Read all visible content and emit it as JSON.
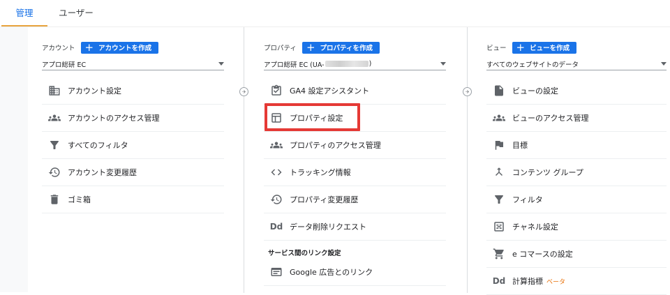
{
  "tabs": [
    {
      "label": "管理",
      "active": true
    },
    {
      "label": "ユーザー",
      "active": false
    }
  ],
  "account": {
    "label": "アカウント",
    "create": "アカウントを作成",
    "selected": "アプロ総研 EC",
    "items": [
      {
        "icon": "building-icon",
        "label": "アカウント設定"
      },
      {
        "icon": "people-icon",
        "label": "アカウントのアクセス管理"
      },
      {
        "icon": "filter-icon",
        "label": "すべてのフィルタ"
      },
      {
        "icon": "history-icon",
        "label": "アカウント変更履歴"
      },
      {
        "icon": "trash-icon",
        "label": "ゴミ箱"
      }
    ]
  },
  "property": {
    "label": "プロパティ",
    "create": "プロパティを作成",
    "selected_prefix": "アプロ総研 EC (UA-",
    "selected_suffix": ")",
    "items": [
      {
        "icon": "checklist-icon",
        "label": "GA4 設定アシスタント"
      },
      {
        "icon": "layout-icon",
        "label": "プロパティ設定"
      },
      {
        "icon": "people-icon",
        "label": "プロパティのアクセス管理"
      },
      {
        "icon": "code-icon",
        "label": "トラッキング情報"
      },
      {
        "icon": "history-icon",
        "label": "プロパティ変更履歴"
      },
      {
        "icon": "dd-icon",
        "label": "データ削除リクエスト",
        "glyph": "Dd"
      }
    ],
    "section_title": "サービス間のリンク設定",
    "links": [
      {
        "icon": "google-ads-icon",
        "label": "Google 広告とのリンク"
      }
    ]
  },
  "view": {
    "label": "ビュー",
    "create": "ビューを作成",
    "selected": "すべてのウェブサイトのデータ",
    "items": [
      {
        "icon": "document-icon",
        "label": "ビューの設定"
      },
      {
        "icon": "people-icon",
        "label": "ビューのアクセス管理"
      },
      {
        "icon": "flag-icon",
        "label": "目標"
      },
      {
        "icon": "content-group-icon",
        "label": "コンテンツ グループ"
      },
      {
        "icon": "filter-icon",
        "label": "フィルタ"
      },
      {
        "icon": "channel-icon",
        "label": "チャネル設定"
      },
      {
        "icon": "cart-icon",
        "label": "e コマースの設定"
      },
      {
        "icon": "dd-icon",
        "label": "計算指標",
        "glyph": "Dd",
        "badge": "ベータ"
      }
    ]
  },
  "colors": {
    "accent": "#1a73e8",
    "tab_underline": "#e8a33d",
    "highlight": "#e53935",
    "beta": "#e8710a"
  }
}
